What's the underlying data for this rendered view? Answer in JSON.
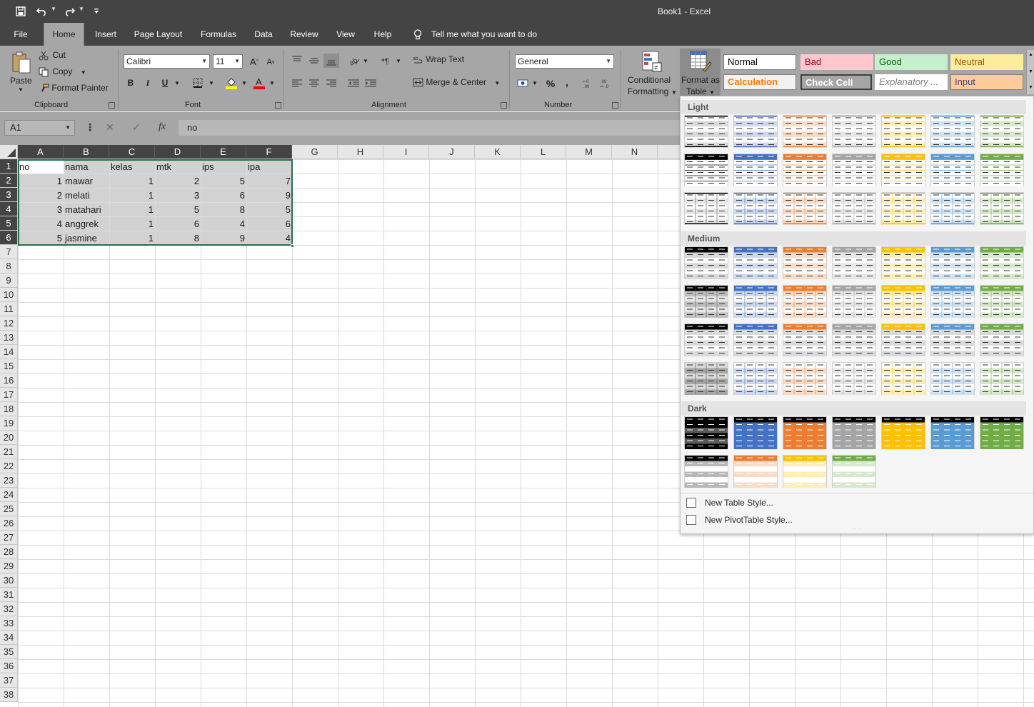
{
  "app": {
    "title": "Book1  -  Excel"
  },
  "quick_access": {
    "save_icon": "save-icon",
    "undo_icon": "undo-icon",
    "redo_icon": "redo-icon",
    "customize_icon": "customize-qat-icon"
  },
  "tabs": [
    {
      "label": "File",
      "active": false
    },
    {
      "label": "Home",
      "active": true
    },
    {
      "label": "Insert",
      "active": false
    },
    {
      "label": "Page Layout",
      "active": false
    },
    {
      "label": "Formulas",
      "active": false
    },
    {
      "label": "Data",
      "active": false
    },
    {
      "label": "Review",
      "active": false
    },
    {
      "label": "View",
      "active": false
    },
    {
      "label": "Help",
      "active": false
    }
  ],
  "tell_me": "Tell me what you want to do",
  "clipboard": {
    "paste": "Paste",
    "cut": "Cut",
    "copy": "Copy",
    "format_painter": "Format Painter",
    "group": "Clipboard"
  },
  "font": {
    "name": "Calibri",
    "size": "11",
    "bold": "B",
    "italic": "I",
    "underline": "U",
    "grow": "A",
    "shrink": "A",
    "group": "Font",
    "highlight_color": "#ffff00",
    "font_color": "#ff0000"
  },
  "alignment": {
    "wrap_text": "Wrap Text",
    "merge_center": "Merge & Center",
    "group": "Alignment"
  },
  "number": {
    "format": "General",
    "percent": "%",
    "comma": ",",
    "group": "Number"
  },
  "styles": {
    "conditional_formatting_line1": "Conditional",
    "conditional_formatting_line2": "Formatting",
    "format_as_table_line1": "Format as",
    "format_as_table_line2": "Table",
    "cells": [
      {
        "label": "Normal",
        "bg": "#ffffff",
        "fg": "#000000",
        "border": "#7a7a7a"
      },
      {
        "label": "Bad",
        "bg": "#ffc7ce",
        "fg": "#9c0006",
        "border": "#ffc7ce"
      },
      {
        "label": "Good",
        "bg": "#c6efce",
        "fg": "#006100",
        "border": "#c6efce"
      },
      {
        "label": "Neutral",
        "bg": "#ffeb9c",
        "fg": "#9c5700",
        "border": "#ffeb9c"
      },
      {
        "label": "Calculation",
        "bg": "#f2f2f2",
        "fg": "#fa7d00",
        "border": "#7f7f7f"
      },
      {
        "label": "Check Cell",
        "bg": "#a5a5a5",
        "fg": "#ffffff",
        "border": "#3f3f3f"
      },
      {
        "label": "Explanatory ...",
        "bg": "#ffffff",
        "fg": "#7f7f7f",
        "border": "#ffffff"
      },
      {
        "label": "Input",
        "bg": "#ffcc99",
        "fg": "#3f3f76",
        "border": "#7f7f7f"
      }
    ]
  },
  "formula_bar": {
    "name_box": "A1",
    "cancel": "✕",
    "enter": "✓",
    "fx": "fx",
    "content": "no"
  },
  "columns": [
    "A",
    "B",
    "C",
    "D",
    "E",
    "F",
    "G",
    "H",
    "I",
    "J",
    "K",
    "L",
    "M",
    "N"
  ],
  "rows": [
    "1",
    "2",
    "3",
    "4",
    "5",
    "6",
    "7",
    "8",
    "9",
    "10",
    "11",
    "12",
    "13",
    "14",
    "15",
    "16",
    "17",
    "18",
    "19",
    "20",
    "21",
    "22",
    "23",
    "24",
    "25",
    "26",
    "27",
    "28",
    "29",
    "30",
    "31",
    "32",
    "33",
    "34",
    "35",
    "36",
    "37",
    "38"
  ],
  "sheet": {
    "headers": [
      "no",
      "nama",
      "kelas",
      "mtk",
      "ips",
      "ipa"
    ],
    "data": [
      [
        "1",
        "mawar",
        "1",
        "2",
        "5",
        "7"
      ],
      [
        "2",
        "melati",
        "1",
        "3",
        "6",
        "9"
      ],
      [
        "3",
        "matahari",
        "1",
        "5",
        "8",
        "5"
      ],
      [
        "4",
        "anggrek",
        "1",
        "6",
        "4",
        "6"
      ],
      [
        "5",
        "jasmine",
        "1",
        "8",
        "9",
        "4"
      ]
    ]
  },
  "table_styles": {
    "sections": [
      {
        "label": "Light"
      },
      {
        "label": "Medium"
      },
      {
        "label": "Dark"
      }
    ],
    "palette": [
      "#000000",
      "#4472c4",
      "#ed7d31",
      "#a5a5a5",
      "#ffc000",
      "#5b9bd5",
      "#70ad47"
    ],
    "new_table_style": "New Table Style...",
    "new_pivot_style": "New PivotTable Style..."
  }
}
